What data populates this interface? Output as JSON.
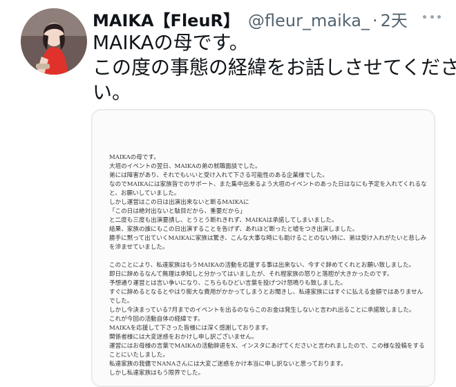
{
  "tweet": {
    "display_name": "MAIKA【FleuR】",
    "handle": "@fleur_maika_",
    "separator": "·",
    "time": "2天",
    "text_lines": [
      "MAIKAの母です。",
      "この度の事態の経緯をお話しさせてくださ",
      "い。"
    ]
  },
  "document": {
    "paragraph1": [
      "MAIKAの母です。",
      "大垣のイベントの翌日、MAIKAの弟の就職面談でした。",
      "弟には障害があり、それでもいいと受け入れて下さる可能性のある企業様でした。",
      "なのでMAIKAには家族皆でのサポート、また集中出来るよう大垣のイベントのあった日はなにも予定を入れてくれるな",
      "と、お願いしていました。",
      "しかし運営はこの日は出演出来ないと断るMAIKAに",
      "「この日は絶対出ないと駄目だから、重要だから」",
      "と二度も三度も出演要請し、とうとう断れきれず、MAIKAは承諾してしまいました。",
      "結果、家族の誰にもこの日出演することを告げず、あれほど断ったと嘘をつき出演しました。",
      "勝手に黙って出ていくMAIKAに家族は驚き、こんな大事な時にも助けることのない姉に、弟は受け入れがたいと悲しみ",
      "を滲ませていました。"
    ],
    "paragraph2": [
      "このことにより、私達家族はもうMAIKAの活動を応援する事は出来ない、今すぐ辞めてくれとお願い致しました。",
      "即日に辞めるなんて無理は承知しと分かってはいましたが、それ程家族の怒りと落胆が大きかったのです。",
      "予想通り運営とは言い争いになり、こちらもひどい言葉を投げつけ怒鳴りも致しました。",
      "すぐに辞めるとなるとやはり膨大な費用がかかってしまうとお聞きし、私達家族にはすぐに払える金額ではありません",
      "でした。",
      "しかし今決まっている7月までのイベントを出るのならこのお金は発生しないと言われ出ることに承諾致しました。",
      "これが今回の活動自体の経緯です。",
      "MAIKAを応援して下さった皆様には深く感謝しております。",
      "関係者様には大変迷惑をおかけし申し訳ございません。",
      "運営にはお母様の言葉でMAIKAの活動辞退をX、インスタにあげてくださいと言われましたので、この様な投稿をする",
      "ことにいたしました。",
      "私達家族の我儘でNANAさんには大変ご迷惑をかけ本当に申し訳ないと思っております。",
      "しかし私達家族はもう限界でした。"
    ]
  }
}
